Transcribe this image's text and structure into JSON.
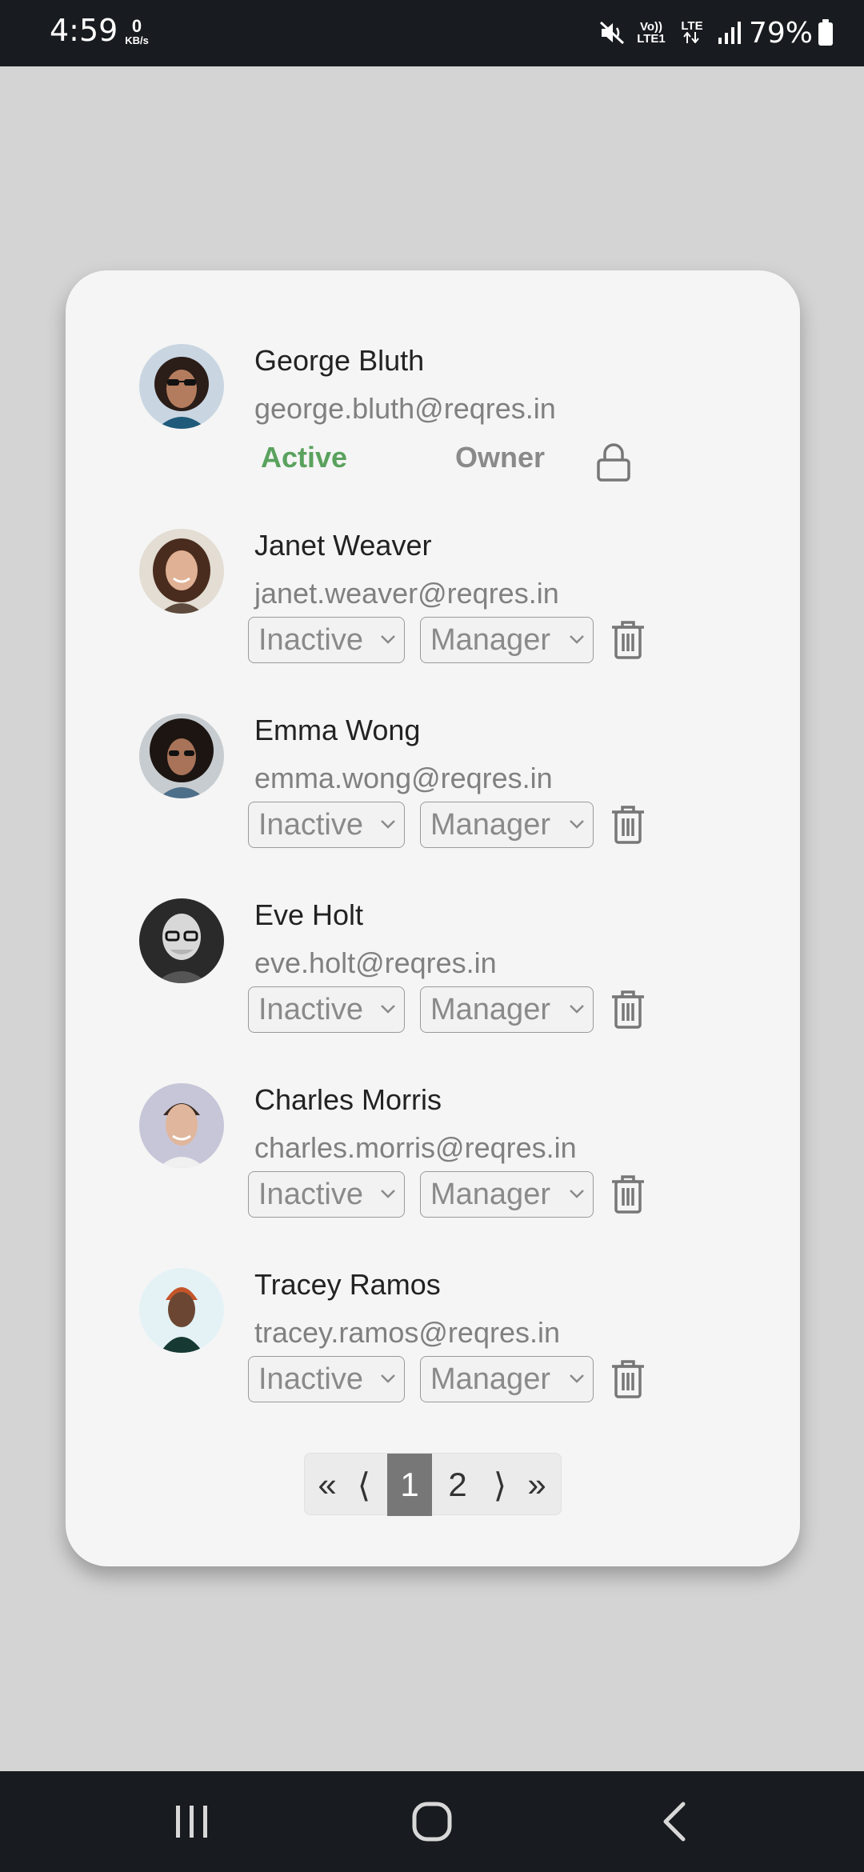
{
  "status_bar": {
    "time": "4:59",
    "data_rate_value": "0",
    "data_rate_unit": "KB/s",
    "network_volte": "Vo)) LTE1",
    "network_lte": "LTE",
    "battery": "79%"
  },
  "users": [
    {
      "name": "George Bluth",
      "email": "george.bluth@reqres.in",
      "status": "Active",
      "role": "Owner",
      "locked": true
    },
    {
      "name": "Janet Weaver",
      "email": "janet.weaver@reqres.in",
      "status": "Inactive",
      "role": "Manager"
    },
    {
      "name": "Emma Wong",
      "email": "emma.wong@reqres.in",
      "status": "Inactive",
      "role": "Manager"
    },
    {
      "name": "Eve Holt",
      "email": "eve.holt@reqres.in",
      "status": "Inactive",
      "role": "Manager"
    },
    {
      "name": "Charles Morris",
      "email": "charles.morris@reqres.in",
      "status": "Inactive",
      "role": "Manager"
    },
    {
      "name": "Tracey Ramos",
      "email": "tracey.ramos@reqres.in",
      "status": "Inactive",
      "role": "Manager"
    }
  ],
  "pagination": {
    "first": "«",
    "prev": "⟨",
    "pages": [
      "1",
      "2"
    ],
    "current": "1",
    "next": "⟩",
    "last": "»"
  },
  "colors": {
    "active": "#5aa25e",
    "card": "#f5f5f5",
    "background": "#d4d4d4",
    "page_current": "#777777"
  },
  "icons": {
    "lock": "lock-icon",
    "delete": "trash-icon",
    "dropdown": "chevron-down-icon"
  }
}
